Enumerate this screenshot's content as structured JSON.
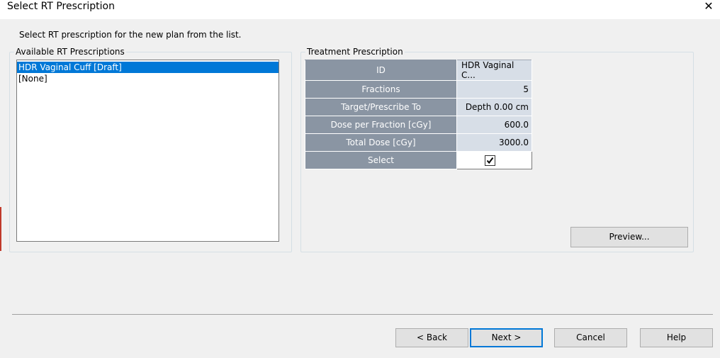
{
  "window": {
    "title": "Select RT Prescription",
    "close_glyph": "✕"
  },
  "instruction": "Select RT prescription for the new plan from the list.",
  "available": {
    "label": "Available RT Prescriptions",
    "items": [
      {
        "label": "HDR Vaginal Cuff [Draft]",
        "selected": true
      },
      {
        "label": "[None]",
        "selected": false
      }
    ]
  },
  "treatment": {
    "label": "Treatment Prescription",
    "rows": [
      {
        "field": "ID",
        "value": "HDR Vaginal C..."
      },
      {
        "field": "Fractions",
        "value": "5"
      },
      {
        "field": "Target/Prescribe To",
        "value": "Depth 0.00 cm"
      },
      {
        "field": "Dose per Fraction [cGy]",
        "value": "600.0"
      },
      {
        "field": "Total Dose [cGy]",
        "value": "3000.0"
      },
      {
        "field": "Select",
        "value": "",
        "checked": true
      }
    ],
    "preview_label": "Preview..."
  },
  "footer": {
    "back_label": "< Back",
    "next_label": "Next >",
    "cancel_label": "Cancel",
    "help_label": "Help"
  },
  "colors": {
    "selection": "#0078d7",
    "header_cell": "#8a95a3",
    "value_cell": "#d7dee7",
    "background": "#f0f0f0"
  }
}
